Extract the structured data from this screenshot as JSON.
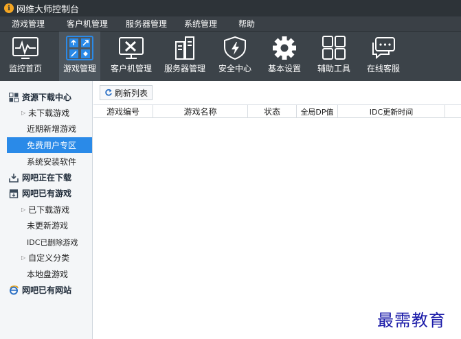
{
  "window": {
    "title": "网维大师控制台",
    "app_icon": "info-circle-icon"
  },
  "menu": [
    "游戏管理",
    "客户机管理",
    "服务器管理",
    "系统管理",
    "帮助"
  ],
  "toolbar": {
    "items": [
      {
        "label": "监控首页",
        "icon": "monitor-pulse-icon",
        "active": false
      },
      {
        "label": "游戏管理",
        "icon": "game-grid-icon",
        "active": true
      },
      {
        "label": "客户机管理",
        "icon": "client-tools-icon",
        "active": false
      },
      {
        "label": "服务器管理",
        "icon": "server-icon",
        "active": false
      },
      {
        "label": "安全中心",
        "icon": "shield-icon",
        "active": false
      },
      {
        "label": "基本设置",
        "icon": "gear-icon",
        "active": false
      },
      {
        "label": "辅助工具",
        "icon": "grid-icon",
        "active": false
      },
      {
        "label": "在线客服",
        "icon": "chat-icon",
        "active": false
      }
    ]
  },
  "sidebar": {
    "sections": [
      {
        "label": "资源下载中心",
        "icon": "download-center-icon"
      },
      {
        "label": "网吧正在下载",
        "icon": "download-tray-icon"
      },
      {
        "label": "网吧已有游戏",
        "icon": "archive-box-icon"
      },
      {
        "label": "网吧已有网站",
        "icon": "ie-browser-icon"
      }
    ],
    "items": [
      {
        "label": "未下载游戏",
        "expandable": true
      },
      {
        "label": "近期新增游戏",
        "expandable": false
      },
      {
        "label": "免费用户专区",
        "expandable": false,
        "selected": true
      },
      {
        "label": "系统安装软件",
        "expandable": false
      },
      {
        "label": "已下载游戏",
        "expandable": true
      },
      {
        "label": "未更新游戏",
        "expandable": false
      },
      {
        "label": "IDC已删除游戏",
        "expandable": false
      },
      {
        "label": "自定义分类",
        "expandable": true
      },
      {
        "label": "本地盘游戏",
        "expandable": false
      }
    ]
  },
  "content": {
    "refresh_label": "刷新列表",
    "columns": [
      "游戏编号",
      "游戏名称",
      "状态",
      "全局DP值",
      "IDC更新时间"
    ]
  },
  "watermark": "最需教育",
  "colors": {
    "selected": "#2a8ae8",
    "toolbar_bg": "#3c4349",
    "title_bg": "#2d3338",
    "accent_icon": "#2a8ae8"
  }
}
